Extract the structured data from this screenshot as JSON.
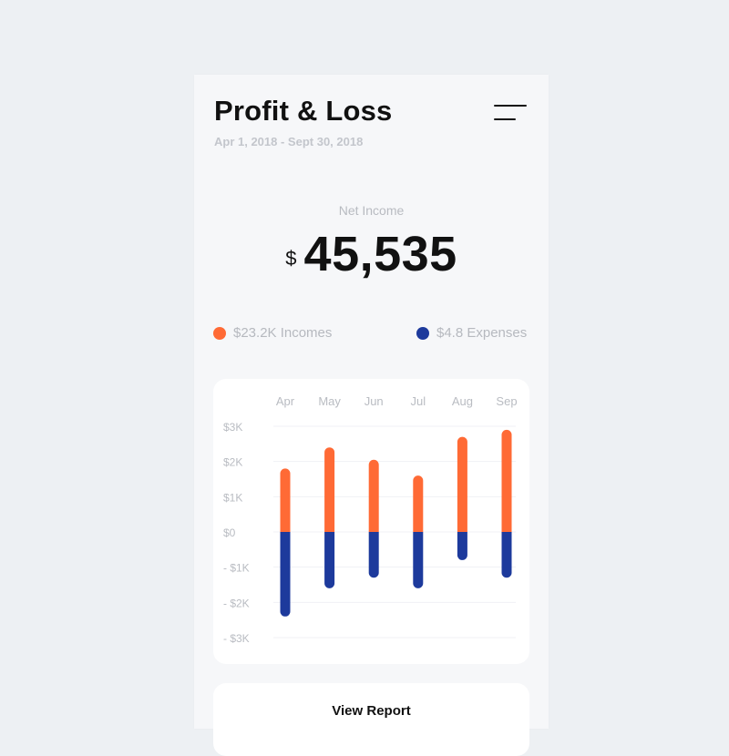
{
  "header": {
    "title": "Profit & Loss",
    "date_range": "Apr 1, 2018 - Sept 30, 2018"
  },
  "summary": {
    "label": "Net Income",
    "currency": "$",
    "amount": "45,535"
  },
  "legend": {
    "income_label": "$23.2K Incomes",
    "expense_label": "$4.8 Expenses"
  },
  "colors": {
    "income": "#ff6a35",
    "expense": "#1d3a9c",
    "gridline": "#f0f1f4",
    "axis_text": "#b9bcc2"
  },
  "chart_data": {
    "type": "bar",
    "categories": [
      "Apr",
      "May",
      "Jun",
      "Jul",
      "Aug",
      "Sep"
    ],
    "series": [
      {
        "name": "Incomes",
        "values": [
          1800,
          2400,
          2050,
          1600,
          2700,
          2900
        ]
      },
      {
        "name": "Expenses",
        "values": [
          -2400,
          -1600,
          -1300,
          -1600,
          -800,
          -1300
        ]
      }
    ],
    "y_ticks": [
      "$3K",
      "$2K",
      "$1K",
      "$0",
      "- $1K",
      "- $2K",
      "- $3K"
    ],
    "ylim": [
      -3000,
      3000
    ],
    "x_axis_position": "top"
  },
  "actions": {
    "view_report": "View Report"
  }
}
